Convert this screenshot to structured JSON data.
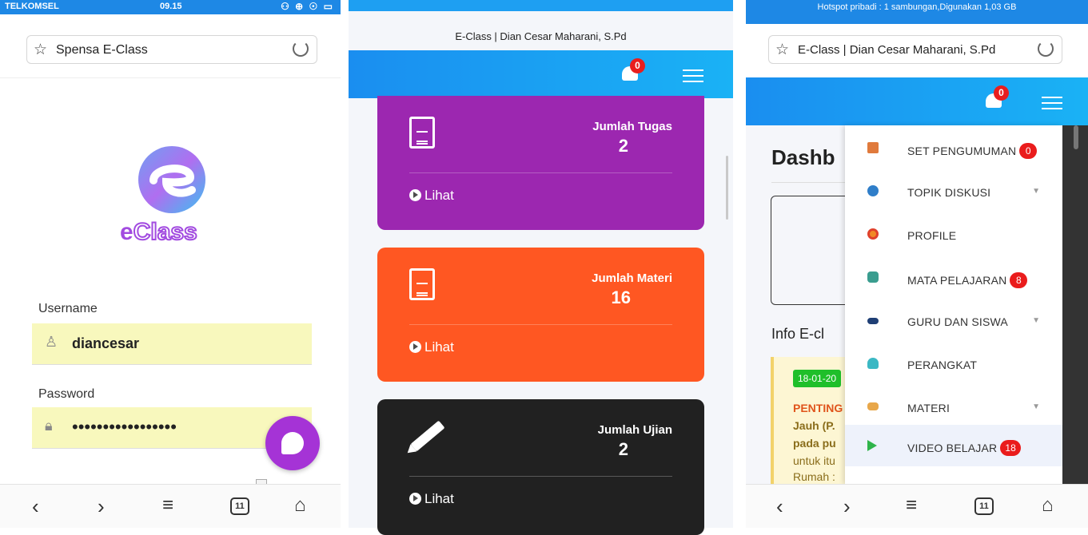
{
  "panel1": {
    "status": {
      "carrier": "TELKOMSEL",
      "time": "09.15",
      "icons": "⚇ ⊕ ☉ ▭"
    },
    "urlbar": {
      "title": "Spensa E-Class"
    },
    "logo_text_e": "e",
    "logo_text_rest": "Class",
    "username_label": "Username",
    "username_value": "diancesar",
    "password_label": "Password",
    "password_dots": "•••••••••••••••••",
    "tab_count": "11"
  },
  "panel2": {
    "page_title": "E-Class | Dian Cesar Maharani, S.Pd",
    "notif_count": "0",
    "cards": [
      {
        "label": "Jumlah Tugas",
        "value": "2",
        "link": "Lihat",
        "color": "#9c27b0"
      },
      {
        "label": "Jumlah Materi",
        "value": "16",
        "link": "Lihat",
        "color": "#ff5722"
      },
      {
        "label": "Jumlah Ujian",
        "value": "2",
        "link": "Lihat",
        "color": "#212121"
      }
    ]
  },
  "panel3": {
    "status": "Hotspot pribadi : 1 sambungan,Digunakan 1,03 GB",
    "urlbar": {
      "title": "E-Class | Dian Cesar Maharani, S.Pd"
    },
    "notif_count": "0",
    "dashboard_title": "Dashb",
    "info_title": "Info E-cl",
    "info": {
      "date": "18-01-20",
      "line1": "PENTING",
      "line2": "Jauh (P.",
      "line3": "pada pu",
      "line4": "untuk itu",
      "line5": "Rumah :"
    },
    "menu": [
      {
        "label": "SET PENGUMUMAN",
        "badge": "0",
        "icon": "megaphone-icon"
      },
      {
        "label": "TOPIK DISKUSI",
        "badge": "",
        "icon": "chat-icon",
        "caret": true
      },
      {
        "label": "PROFILE",
        "badge": "",
        "icon": "profile-icon"
      },
      {
        "label": "MATA PELAJARAN",
        "badge": "8",
        "icon": "books-icon"
      },
      {
        "label": "GURU DAN SISWA",
        "badge": "",
        "icon": "graduation-cap-icon",
        "caret": true
      },
      {
        "label": "PERANGKAT",
        "badge": "",
        "icon": "device-icon"
      },
      {
        "label": "MATERI",
        "badge": "",
        "icon": "map-icon",
        "caret": true
      },
      {
        "label": "VIDEO BELAJAR",
        "badge": "18",
        "icon": "play-icon"
      }
    ],
    "tab_count": "11"
  },
  "colors": {
    "brand_blue": "#1e88e5",
    "purple": "#9c27b0",
    "orange": "#ff5722",
    "dark": "#212121",
    "badge_red": "#ea1c1c"
  }
}
